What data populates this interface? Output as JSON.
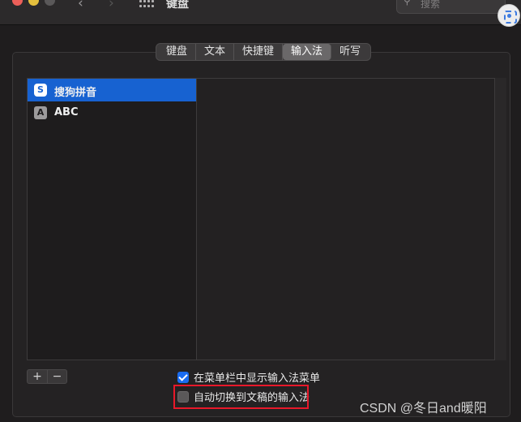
{
  "window": {
    "title": "键盘",
    "nav_back": "‹",
    "nav_forward": "›"
  },
  "search": {
    "icon": "magnifier",
    "placeholder": "搜索"
  },
  "tabs": [
    {
      "label": "键盘",
      "active": false
    },
    {
      "label": "文本",
      "active": false
    },
    {
      "label": "快捷键",
      "active": false
    },
    {
      "label": "输入法",
      "active": true
    },
    {
      "label": "听写",
      "active": false
    }
  ],
  "input_sources": [
    {
      "label": "搜狗拼音",
      "icon_text": "S",
      "selected": true
    },
    {
      "label": "ABC",
      "icon_text": "A",
      "selected": false
    }
  ],
  "list_controls": {
    "add": "+",
    "remove": "−"
  },
  "options": {
    "show_menu": {
      "label": "在菜单栏中显示输入法菜单",
      "checked": true
    },
    "auto_switch": {
      "label": "自动切换到文稿的输入法",
      "checked": false
    }
  },
  "watermark": "CSDN @冬日and暖阳",
  "colors": {
    "accent": "#1762d1",
    "highlight": "#e8182a"
  }
}
